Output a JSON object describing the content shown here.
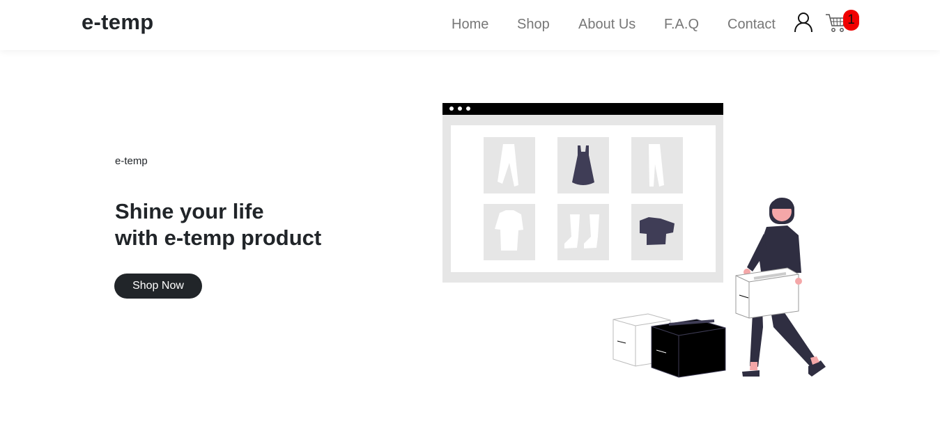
{
  "brand": "e-temp",
  "nav": {
    "items": [
      {
        "label": "Home"
      },
      {
        "label": "Shop"
      },
      {
        "label": "About Us"
      },
      {
        "label": "F.A.Q"
      },
      {
        "label": "Contact"
      }
    ],
    "user_icon": "user-icon",
    "cart_icon": "cart-icon",
    "cart_count": "1"
  },
  "hero": {
    "kicker": "e-temp",
    "title_line1": "Shine your life",
    "title_line2": "with e-temp product",
    "cta_label": "Shop Now"
  },
  "colors": {
    "text": "#212529",
    "nav_link": "#777777",
    "button_bg": "#212529",
    "badge": "#f00000",
    "illustration_dark": "#3f3d56",
    "illustration_light": "#e6e6e6"
  }
}
